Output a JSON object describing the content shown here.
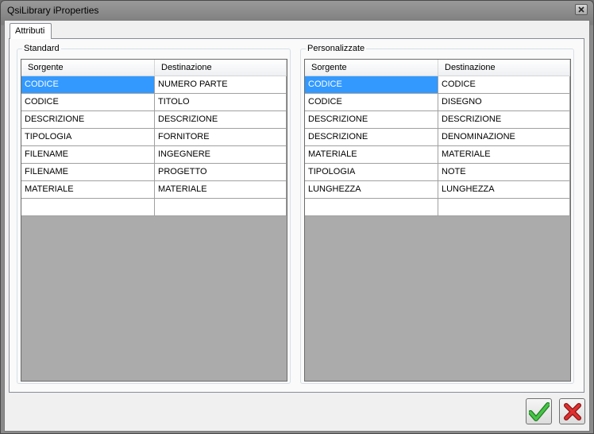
{
  "window": {
    "title": "QsiLibrary iProperties"
  },
  "tab": {
    "label": "Attributi"
  },
  "standard": {
    "label": "Standard",
    "headers": [
      "Sorgente",
      "Destinazione"
    ],
    "rows": [
      [
        "CODICE",
        "NUMERO PARTE"
      ],
      [
        "CODICE",
        "TITOLO"
      ],
      [
        "DESCRIZIONE",
        "DESCRIZIONE"
      ],
      [
        "TIPOLOGIA",
        "FORNITORE"
      ],
      [
        "FILENAME",
        "INGEGNERE"
      ],
      [
        "FILENAME",
        "PROGETTO"
      ],
      [
        "MATERIALE",
        "MATERIALE"
      ],
      [
        "",
        ""
      ]
    ]
  },
  "personalizzate": {
    "label": "Personalizzate",
    "headers": [
      "Sorgente",
      "Destinazione"
    ],
    "rows": [
      [
        "CODICE",
        "CODICE"
      ],
      [
        "CODICE",
        "DISEGNO"
      ],
      [
        "DESCRIZIONE",
        "DESCRIZIONE"
      ],
      [
        "DESCRIZIONE",
        "DENOMINAZIONE"
      ],
      [
        "MATERIALE",
        "MATERIALE"
      ],
      [
        "TIPOLOGIA",
        "NOTE"
      ],
      [
        "LUNGHEZZA",
        "LUNGHEZZA"
      ],
      [
        "",
        ""
      ]
    ]
  },
  "buttons": {
    "ok_icon": "checkmark-icon",
    "cancel_icon": "x-icon"
  },
  "colors": {
    "selection": "#3399ff",
    "grid_background": "#ababab",
    "ok_green": "#2ea82e",
    "cancel_red": "#d62828"
  }
}
